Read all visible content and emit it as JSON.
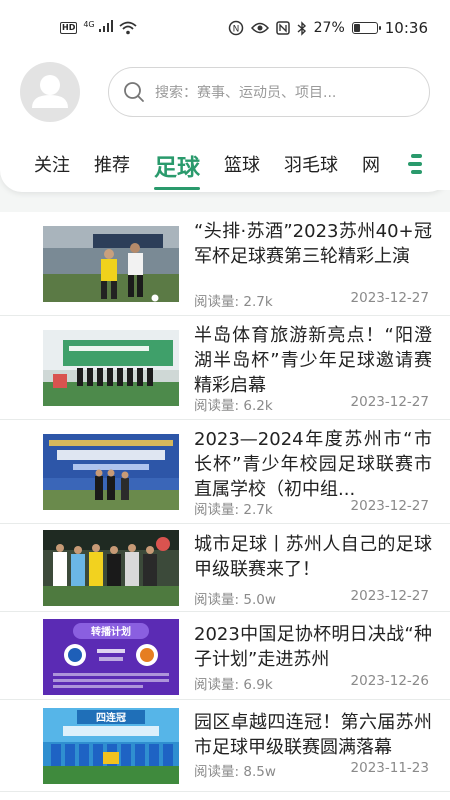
{
  "status_bar": {
    "network_label": "4G",
    "battery": "27%",
    "battery_level": 0.27,
    "time": "10:36"
  },
  "search": {
    "placeholder": "搜索：赛事、运动员、项目..."
  },
  "tabs": [
    {
      "label": "关注",
      "active": false
    },
    {
      "label": "推荐",
      "active": false
    },
    {
      "label": "足球",
      "active": true
    },
    {
      "label": "篮球",
      "active": false
    },
    {
      "label": "羽毛球",
      "active": false
    },
    {
      "label": "网",
      "active": false
    }
  ],
  "colors": {
    "accent": "#2a9a6c"
  },
  "articles": [
    {
      "title": "“头排·苏酒”2023苏州40+冠军杯足球赛第三轮精彩上演",
      "reads_label": "阅读量:",
      "reads": "2.7k",
      "date": "2023-12-27"
    },
    {
      "title": "半岛体育旅游新亮点！“阳澄湖半岛杯”青少年足球邀请赛精彩启幕",
      "reads_label": "阅读量:",
      "reads": "6.2k",
      "date": "2023-12-27"
    },
    {
      "title": "2023—2024年度苏州市“市长杯”青少年校园足球联赛市直属学校（初中组...",
      "reads_label": "阅读量:",
      "reads": "2.7k",
      "date": "2023-12-27"
    },
    {
      "title": "城市足球丨苏州人自己的足球甲级联赛来了！",
      "reads_label": "阅读量:",
      "reads": "5.0w",
      "date": "2023-12-27"
    },
    {
      "title": "2023中国足协杯明日决战“种子计划”走进苏州",
      "reads_label": "阅读量:",
      "reads": "6.9k",
      "date": "2023-12-26"
    },
    {
      "title": "园区卓越四连冠！第六届苏州市足球甲级联赛圆满落幕",
      "reads_label": "阅读量:",
      "reads": "8.5w",
      "date": "2023-11-23"
    }
  ],
  "thumb_text": {
    "a5_banner": "转播计划",
    "a6_banner": "四连冠"
  }
}
